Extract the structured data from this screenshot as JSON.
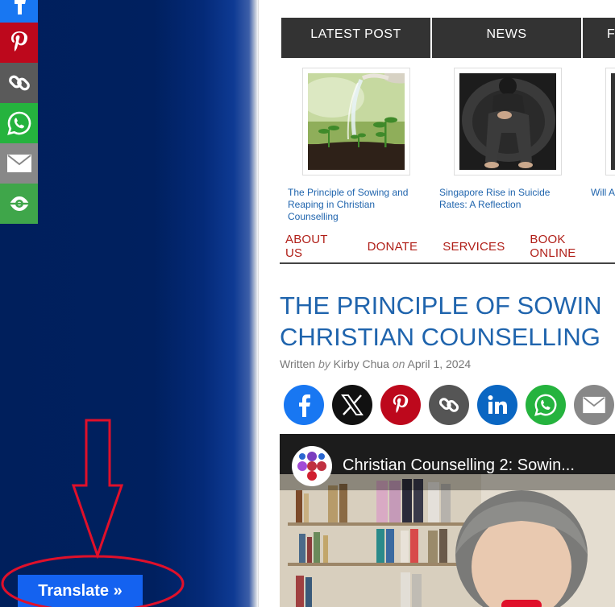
{
  "translate": {
    "label": "Translate »"
  },
  "tabs": [
    "LATEST POST",
    "NEWS",
    "F"
  ],
  "posts": [
    {
      "title": "The Principle of Sowing and Reaping in Christian Counselling"
    },
    {
      "title": "Singapore Rise in Suicide Rates: A Reflection"
    },
    {
      "title": "Will A… Repla…"
    }
  ],
  "nav": [
    "ABOUT US",
    "DONATE",
    "SERVICES",
    "BOOK ONLINE"
  ],
  "article": {
    "title_line1": "THE PRINCIPLE OF SOWIN",
    "title_line2": "CHRISTIAN COUNSELLING",
    "written": "Written",
    "by": "by",
    "author": "Kirby Chua",
    "on": "on",
    "date": "April 1, 2024"
  },
  "video": {
    "title": "Christian Counselling 2: Sowin..."
  },
  "side_share_icons": [
    "facebook-icon",
    "pinterest-icon",
    "copy-link-icon",
    "whatsapp-icon",
    "email-icon",
    "more-share-icon"
  ],
  "article_share_icons": [
    "facebook-icon",
    "x-icon",
    "pinterest-icon",
    "copy-link-icon",
    "linkedin-icon",
    "whatsapp-icon",
    "email-icon"
  ],
  "colors": {
    "background_blue": "#00205f",
    "translate_button": "#1462f0",
    "tab_bg": "#333333",
    "nav_red": "#b01f18",
    "link_blue": "#1f64ad",
    "annotation_red": "#e0102a"
  }
}
